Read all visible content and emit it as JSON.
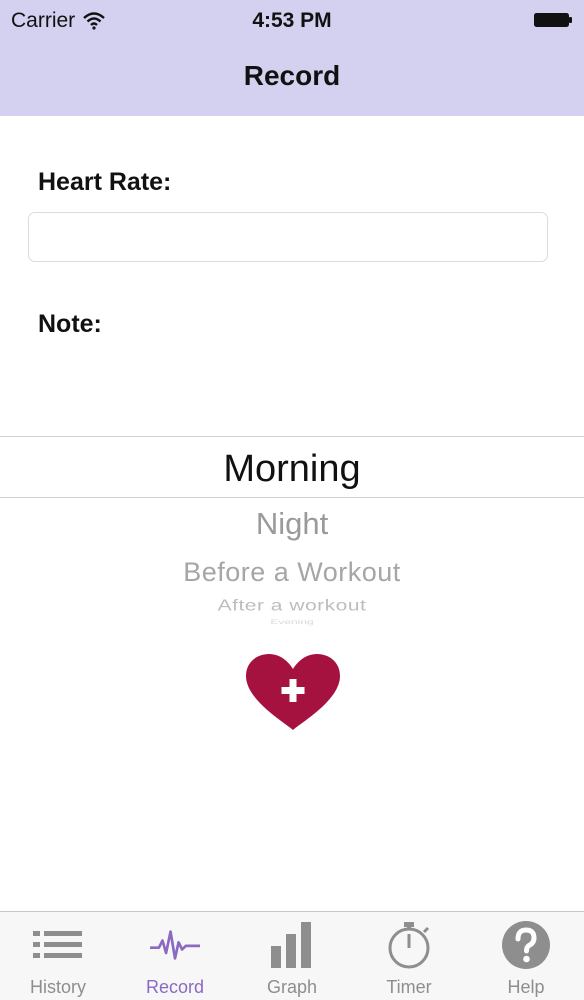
{
  "status_bar": {
    "carrier": "Carrier",
    "time": "4:53 PM",
    "wifi_icon": "wifi-icon",
    "battery_icon": "battery-icon"
  },
  "nav": {
    "title": "Record"
  },
  "form": {
    "heart_rate_label": "Heart Rate:",
    "heart_rate_value": "",
    "note_label": "Note:"
  },
  "picker": {
    "selected": "Morning",
    "items": [
      "Morning",
      "Night",
      "Before a Workout",
      "After a workout",
      "Evening"
    ]
  },
  "add_button": {
    "icon": "heart-plus-icon",
    "color": "#a5123f"
  },
  "tab_bar": {
    "tabs": [
      {
        "label": "History",
        "icon": "list-icon"
      },
      {
        "label": "Record",
        "icon": "heartbeat-icon"
      },
      {
        "label": "Graph",
        "icon": "bar-chart-icon"
      },
      {
        "label": "Timer",
        "icon": "stopwatch-icon"
      },
      {
        "label": "Help",
        "icon": "question-icon"
      }
    ],
    "active_color": "#8a6ac2",
    "inactive_color": "#8e8e8e"
  },
  "colors": {
    "header_background": "#d4d0f0"
  }
}
